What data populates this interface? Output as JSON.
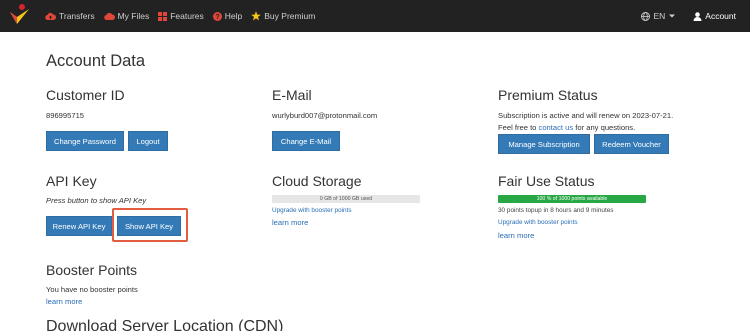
{
  "nav": {
    "items": [
      {
        "label": "Transfers",
        "icon": "cloud-upload-icon",
        "color": "#e0463a"
      },
      {
        "label": "My Files",
        "icon": "cloud-icon",
        "color": "#e0463a"
      },
      {
        "label": "Features",
        "icon": "grid-icon",
        "color": "#e0463a"
      },
      {
        "label": "Help",
        "icon": "question-icon",
        "color": "#e0463a"
      },
      {
        "label": "Buy Premium",
        "icon": "star-icon",
        "color": "#f5c518"
      }
    ],
    "language": "EN",
    "account": "Account"
  },
  "page_title": "Account Data",
  "customer": {
    "title": "Customer ID",
    "id": "896995715",
    "change_password": "Change Password",
    "logout": "Logout"
  },
  "email": {
    "title": "E-Mail",
    "address": "wurlyburd007@protonmail.com",
    "change_email": "Change E-Mail"
  },
  "premium": {
    "title": "Premium Status",
    "line1": "Subscription is active and will renew on 2023-07-21.",
    "line2_prefix": "Feel free to ",
    "line2_link": "contact us",
    "line2_suffix": " for any questions.",
    "manage": "Manage Subscription",
    "redeem": "Redeem Voucher"
  },
  "api": {
    "title": "API Key",
    "hint": "Press button to show API Key",
    "renew": "Renew API Key",
    "show": "Show API Key"
  },
  "cloud": {
    "title": "Cloud Storage",
    "bar_label": "0 GB of 1000 GB used",
    "used_fraction": 0.0,
    "upgrade": "Upgrade with booster points",
    "learn_more": "learn more"
  },
  "fair_use": {
    "title": "Fair Use Status",
    "bar_label": "100 % of 1000 points available",
    "available_fraction": 1.0,
    "topup": "30 points topup in 8 hours and 9 minutes",
    "upgrade": "Upgrade with booster points",
    "learn_more": "learn more"
  },
  "booster": {
    "title": "Booster Points",
    "text": "You have no booster points",
    "learn_more": "learn more"
  },
  "cdn": {
    "title": "Download Server Location (CDN)"
  },
  "colors": {
    "navbar": "#222222",
    "button": "#337ab7",
    "highlight": "#e25d3f",
    "bar_green": "#27a844"
  }
}
